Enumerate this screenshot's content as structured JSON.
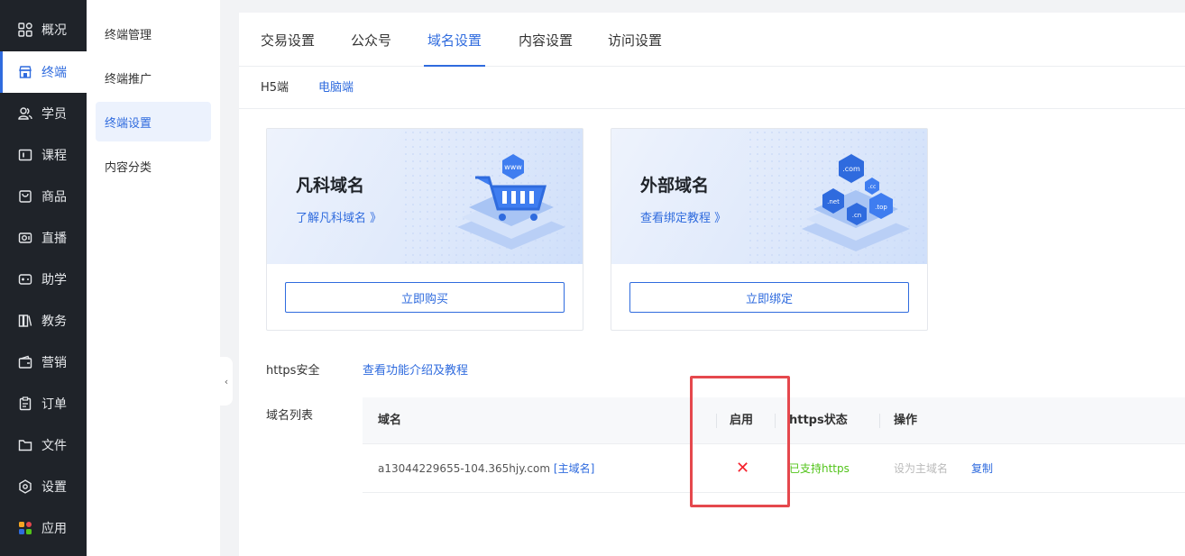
{
  "nav": {
    "items": [
      {
        "label": "概况",
        "icon": "grid-icon"
      },
      {
        "label": "终端",
        "icon": "store-icon"
      },
      {
        "label": "学员",
        "icon": "users-icon"
      },
      {
        "label": "课程",
        "icon": "course-icon"
      },
      {
        "label": "商品",
        "icon": "bag-icon"
      },
      {
        "label": "直播",
        "icon": "camera-icon"
      },
      {
        "label": "助学",
        "icon": "gamepad-icon"
      },
      {
        "label": "教务",
        "icon": "books-icon"
      },
      {
        "label": "营销",
        "icon": "wallet-icon"
      },
      {
        "label": "订单",
        "icon": "clipboard-icon"
      },
      {
        "label": "文件",
        "icon": "folder-icon"
      },
      {
        "label": "设置",
        "icon": "settings-icon"
      },
      {
        "label": "应用",
        "icon": "apps-icon"
      }
    ],
    "active_index": 1
  },
  "submenu": {
    "items": [
      "终端管理",
      "终端推广",
      "终端设置",
      "内容分类"
    ],
    "active_index": 2
  },
  "tabs": {
    "items": [
      "交易设置",
      "公众号",
      "域名设置",
      "内容设置",
      "访问设置"
    ],
    "active_index": 2
  },
  "subtabs": {
    "items": [
      "H5端",
      "电脑端"
    ],
    "active_index": 1
  },
  "cards": [
    {
      "title": "凡科域名",
      "link": "了解凡科域名 》",
      "button": "立即购买",
      "illus_text": "www"
    },
    {
      "title": "外部域名",
      "link": "查看绑定教程 》",
      "button": "立即绑定",
      "illus_tags": [
        ".com",
        ".cc",
        ".net",
        ".top",
        ".cn"
      ]
    }
  ],
  "https": {
    "label": "https安全",
    "link": "查看功能介绍及教程"
  },
  "domain_list": {
    "label": "域名列表",
    "columns": [
      "域名",
      "启用",
      "https状态",
      "操作"
    ],
    "rows": [
      {
        "domain": "a13044229655-104.365hjy.com",
        "primary_tag": "[主域名]",
        "enabled": "✕",
        "https_status": "已支持https",
        "action_set_primary": "设为主域名",
        "action_copy": "复制"
      }
    ]
  },
  "colors": {
    "accent": "#2f6bde",
    "sidebar_bg": "#1f2329",
    "success": "#52c41a",
    "danger": "#f5222d",
    "highlight_box": "#e5484d"
  }
}
